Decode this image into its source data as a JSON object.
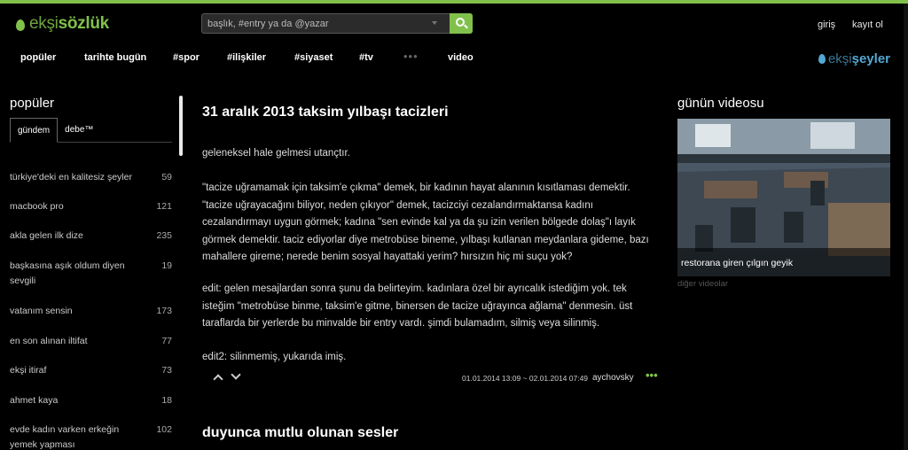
{
  "header": {
    "logo_main": "ekşi",
    "logo_bold": "sözlük",
    "search_placeholder": "başlık, #entry ya da @yazar",
    "login": "giriş",
    "register": "kayıt ol"
  },
  "nav": {
    "items": [
      "popüler",
      "tarihte bugün",
      "#spor",
      "#ilişkiler",
      "#siyaset",
      "#tv",
      "video"
    ],
    "more": "•••",
    "seyler_light": "ekşi",
    "seyler_bold": "şeyler"
  },
  "sidebar": {
    "title": "popüler",
    "tabs": [
      "gündem",
      "debe™"
    ],
    "topics": [
      {
        "title": "türkiye'deki en kalitesiz şeyler",
        "count": "59"
      },
      {
        "title": "macbook pro",
        "count": "121"
      },
      {
        "title": "akla gelen ilk dize",
        "count": "235"
      },
      {
        "title": "başkasına aşık oldum diyen sevgili",
        "count": "19"
      },
      {
        "title": "vatanım sensin",
        "count": "173"
      },
      {
        "title": "en son alınan iltifat",
        "count": "77"
      },
      {
        "title": "ekşi itiraf",
        "count": "73"
      },
      {
        "title": "ahmet kaya",
        "count": "18"
      },
      {
        "title": "evde kadın varken erkeğin yemek yapması",
        "count": "102"
      }
    ]
  },
  "entry": {
    "title": "31 aralık 2013 taksim yılbaşı tacizleri",
    "paragraphs": [
      "geleneksel hale gelmesi utançtır.",
      "\"tacize uğramamak için taksim'e çıkma\" demek, bir kadının hayat alanının kısıtlaması demektir. \"tacize uğrayacağını biliyor, neden çıkıyor\" demek, tacizciyi cezalandırmaktansa kadını cezalandırmayı uygun görmek; kadına \"sen evinde kal ya da şu izin verilen bölgede dolaş\"ı layık görmek demektir. taciz ediyorlar diye metrobüse bineme, yılbaşı kutlanan meydanlara gideme, bazı mahallere gireme; nerede benim sosyal hayattaki yerim? hırsızın hiç mi suçu yok?",
      "edit: gelen mesajlardan sonra şunu da belirteyim. kadınlara özel bir ayrıcalık istediğim yok. tek isteğim \"metrobüse binme, taksim'e gitme, binersen de tacize uğrayınca ağlama\" denmesin. üst taraflarda bir yerlerde bu minvalde bir entry vardı. şimdi bulamadım, silmiş veya silinmiş.",
      "edit2: silinmemiş, yukarıda imiş."
    ],
    "date": "01.01.2014 13:09 ~ 02.01.2014 07:49",
    "author": "aychovsky",
    "more": "•••",
    "next_title": "duyunca mutlu olunan sesler"
  },
  "video": {
    "title": "günün videosu",
    "caption": "restorana giren çılgın geyik",
    "more": "diğer videolar"
  },
  "colors": {
    "accent": "#81c14b",
    "seyler": "#53a8d3",
    "background": "#000000"
  }
}
